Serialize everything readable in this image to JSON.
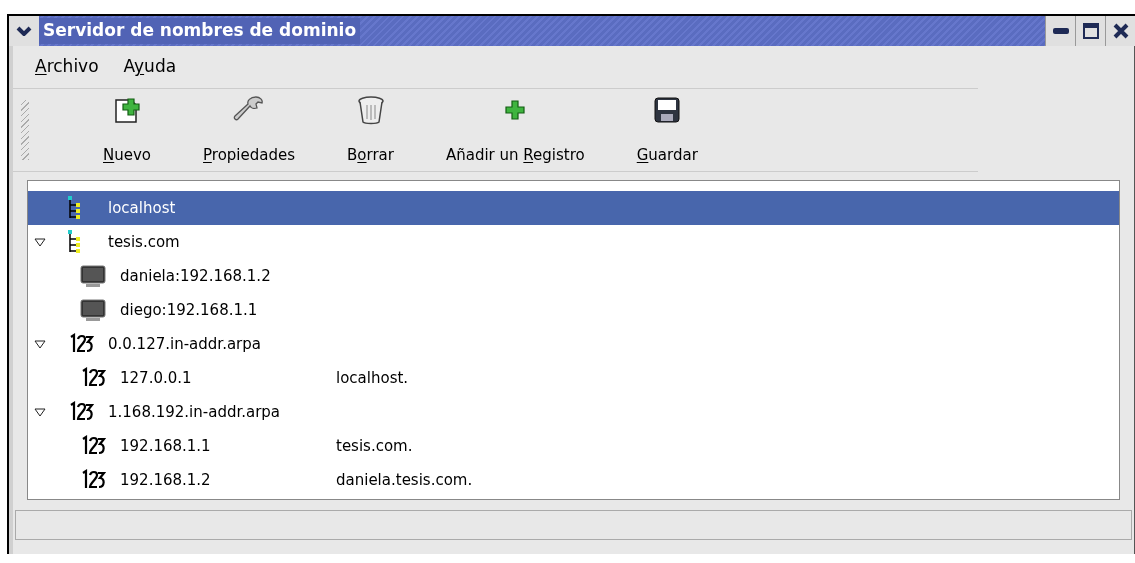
{
  "window": {
    "title": "Servidor de nombres de dominio"
  },
  "menu": [
    {
      "segments": [
        {
          "text": "A",
          "underline": true
        },
        {
          "text": "rchivo",
          "underline": false
        }
      ]
    },
    {
      "segments": [
        {
          "text": "A",
          "underline": false
        },
        {
          "text": "y",
          "underline": true
        },
        {
          "text": "uda",
          "underline": false
        }
      ]
    }
  ],
  "toolbar": [
    {
      "kind": "new",
      "segments": [
        {
          "text": "N",
          "underline": true
        },
        {
          "text": "uevo",
          "underline": false
        }
      ]
    },
    {
      "kind": "properties",
      "segments": [
        {
          "text": "P",
          "underline": true
        },
        {
          "text": "ropiedades",
          "underline": false
        }
      ]
    },
    {
      "kind": "delete",
      "segments": [
        {
          "text": "B",
          "underline": false
        },
        {
          "text": "o",
          "underline": true
        },
        {
          "text": "rrar",
          "underline": false
        }
      ]
    },
    {
      "kind": "add",
      "segments": [
        {
          "text": "Añadir un ",
          "underline": false
        },
        {
          "text": "R",
          "underline": true
        },
        {
          "text": "egistro",
          "underline": false
        }
      ]
    },
    {
      "kind": "save",
      "segments": [
        {
          "text": "G",
          "underline": true
        },
        {
          "text": "uardar",
          "underline": false
        }
      ]
    }
  ],
  "tree": [
    {
      "kind": "zone",
      "name": "localhost",
      "selected": true
    },
    {
      "kind": "zone",
      "name": "tesis.com",
      "selected": false,
      "expanded": true,
      "children": [
        {
          "kind": "host",
          "name": "daniela:192.168.1.2",
          "selected": false
        },
        {
          "kind": "host",
          "name": "diego:192.168.1.1",
          "selected": false
        }
      ]
    },
    {
      "kind": "reverse",
      "name": "0.0.127.in-addr.arpa",
      "selected": false,
      "expanded": true,
      "children": [
        {
          "kind": "reverse",
          "name": "127.0.0.1",
          "value": "localhost.",
          "selected": false
        }
      ]
    },
    {
      "kind": "reverse",
      "name": "1.168.192.in-addr.arpa",
      "selected": false,
      "expanded": true,
      "children": [
        {
          "kind": "reverse",
          "name": "192.168.1.1",
          "value": "tesis.com.",
          "selected": false
        },
        {
          "kind": "reverse",
          "name": "192.168.1.2",
          "value": "daniela.tesis.com.",
          "selected": false
        }
      ]
    }
  ]
}
